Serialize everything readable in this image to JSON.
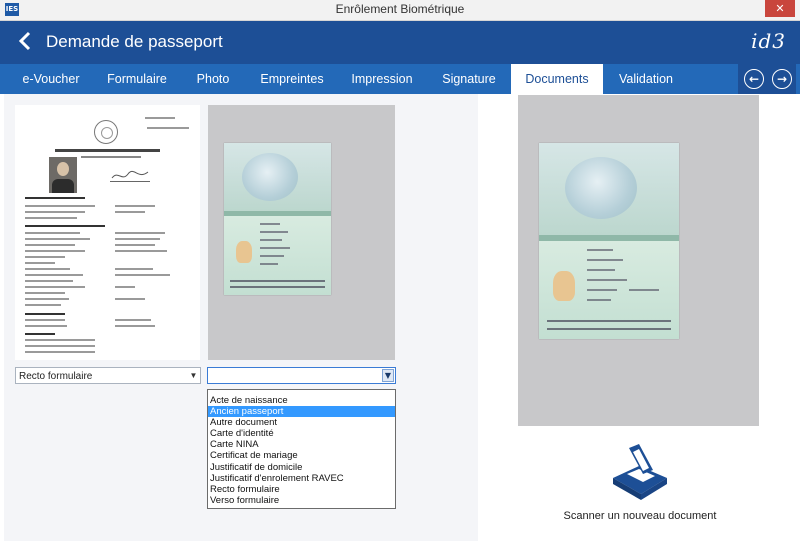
{
  "window": {
    "title": "Enrôlement Biométrique",
    "close": "✕",
    "app_icon": "IES"
  },
  "header": {
    "title": "Demande de passeport",
    "logo": "id3",
    "back_icon": "chevron-left-icon"
  },
  "tabs": [
    {
      "label": "e-Voucher",
      "active": false
    },
    {
      "label": "Formulaire",
      "active": false
    },
    {
      "label": "Photo",
      "active": false
    },
    {
      "label": "Empreintes",
      "active": false
    },
    {
      "label": "Impression",
      "active": false
    },
    {
      "label": "Signature",
      "active": false
    },
    {
      "label": "Documents",
      "active": true
    },
    {
      "label": "Validation",
      "active": false
    }
  ],
  "nav": {
    "prev": "←",
    "next": "→"
  },
  "documents": {
    "slot1_type": "Recto formulaire",
    "slot2_type": "",
    "options": [
      "Acte de naissance",
      "Ancien passeport",
      "Autre document",
      "Carte d'identité",
      "Carte NINA",
      "Certificat de mariage",
      "Justificatif de domicile",
      "Justificatif d'enrolement RAVEC",
      "Recto formulaire",
      "Verso formulaire"
    ],
    "highlighted_option": "Ancien passeport"
  },
  "scan": {
    "label": "Scanner un nouveau document"
  },
  "colors": {
    "header": "#1d4f96",
    "tabs": "#2369b8",
    "highlight": "#3399ff",
    "close": "#c9463d"
  }
}
